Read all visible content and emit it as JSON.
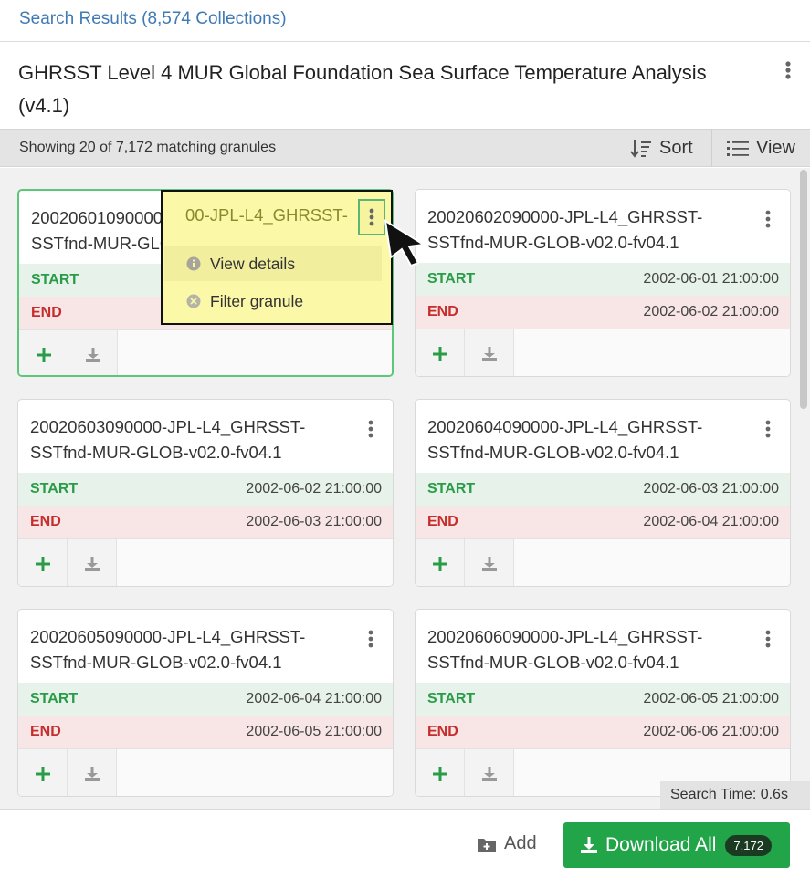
{
  "header": {
    "breadcrumb": "Search Results (8,574 Collections)",
    "collection_title": "GHRSST Level 4 MUR Global Foundation Sea Surface Temperature Analysis (v4.1)"
  },
  "toolbar": {
    "showing": "Showing 20 of 7,172 matching granules",
    "sort_label": "Sort",
    "view_label": "View"
  },
  "labels": {
    "start": "START",
    "end": "END"
  },
  "granules": [
    {
      "name": "20020601090000-JPL-L4_GHRSST-SSTfnd-MUR-GLOB-v02.0-fv04.1",
      "start": "",
      "end": ""
    },
    {
      "name": "20020602090000-JPL-L4_GHRSST-SSTfnd-MUR-GLOB-v02.0-fv04.1",
      "start": "2002-06-01 21:00:00",
      "end": "2002-06-02 21:00:00"
    },
    {
      "name": "20020603090000-JPL-L4_GHRSST-SSTfnd-MUR-GLOB-v02.0-fv04.1",
      "start": "2002-06-02 21:00:00",
      "end": "2002-06-03 21:00:00"
    },
    {
      "name": "20020604090000-JPL-L4_GHRSST-SSTfnd-MUR-GLOB-v02.0-fv04.1",
      "start": "2002-06-03 21:00:00",
      "end": "2002-06-04 21:00:00"
    },
    {
      "name": "20020605090000-JPL-L4_GHRSST-SSTfnd-MUR-GLOB-v02.0-fv04.1",
      "start": "2002-06-04 21:00:00",
      "end": "2002-06-05 21:00:00"
    },
    {
      "name": "20020606090000-JPL-L4_GHRSST-SSTfnd-MUR-GLOB-v02.0-fv04.1",
      "start": "2002-06-05 21:00:00",
      "end": "2002-06-06 21:00:00"
    }
  ],
  "context_menu": {
    "items": [
      "View details",
      "Filter granule"
    ]
  },
  "status": {
    "search_time": "Search Time: 0.6s"
  },
  "footer": {
    "add_label": "Add",
    "download_all_label": "Download All",
    "download_count": "7,172"
  },
  "colors": {
    "accent_link": "#3f7ab5",
    "start_green": "#2a9c48",
    "end_red": "#c62d2d",
    "download_green": "#22a449",
    "menu_highlight": "#fbf8a8"
  }
}
